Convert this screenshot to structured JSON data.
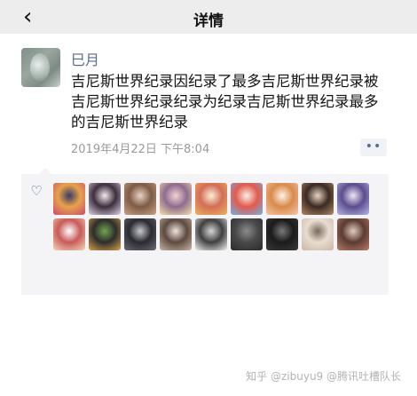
{
  "header": {
    "title": "详情",
    "back_icon": "back-chevron-icon"
  },
  "post": {
    "username": "巳月",
    "content": "吉尼斯世界纪录因纪录了最多吉尼斯世界纪录被吉尼斯世界纪录纪录为纪录吉尼斯世界纪录最多的吉尼斯世界纪录",
    "time": "2019年4月22日 下午8:04",
    "more_label": "••"
  },
  "likes": {
    "icon": "heart-outline-icon",
    "avatar_colors": [
      [
        "#c84b6d",
        "#e8a24c",
        "#3a3a66"
      ],
      [
        "#dcd3e6",
        "#3d2f3c",
        "#f2e9ef"
      ],
      [
        "#c9a286",
        "#7e5b46",
        "#e7d3c2"
      ],
      [
        "#f4e2a8",
        "#8f6c8e",
        "#f5d2d5"
      ],
      [
        "#e7b45b",
        "#d46d57",
        "#fbeed6"
      ],
      [
        "#6eb2e1",
        "#e35a4f",
        "#f7f0e6"
      ],
      [
        "#f3c7a8",
        "#d98a4c",
        "#fff3e6"
      ],
      [
        "#b18a6b",
        "#3a2a21",
        "#e8d3c2"
      ],
      [
        "#b6b6e6",
        "#5c4d8e",
        "#efe7f5"
      ],
      [
        "#f3d9b8",
        "#c85a5a",
        "#ffffff"
      ],
      [
        "#d8a14b",
        "#2d2d2d",
        "#71a54c"
      ],
      [
        "#6b6b73",
        "#2a2a30",
        "#c8c8d0"
      ],
      [
        "#c9b4a6",
        "#5d4a40",
        "#eee3dc"
      ],
      [
        "#f2f2f2",
        "#404040",
        "#d6d6d6"
      ],
      [
        "#2a2a2a",
        "#4a4a4a",
        "#8b8b8b"
      ],
      [
        "#3a3a3a",
        "#1b1b1b",
        "#7a7a7a"
      ],
      [
        "#c9b6a4",
        "#e8ddd1",
        "#7a6a5c"
      ],
      [
        "#b87c6b",
        "#5b3b33",
        "#e4cbbf"
      ]
    ]
  },
  "watermark": "知乎 @zibuyu9 @腾讯吐槽队长"
}
